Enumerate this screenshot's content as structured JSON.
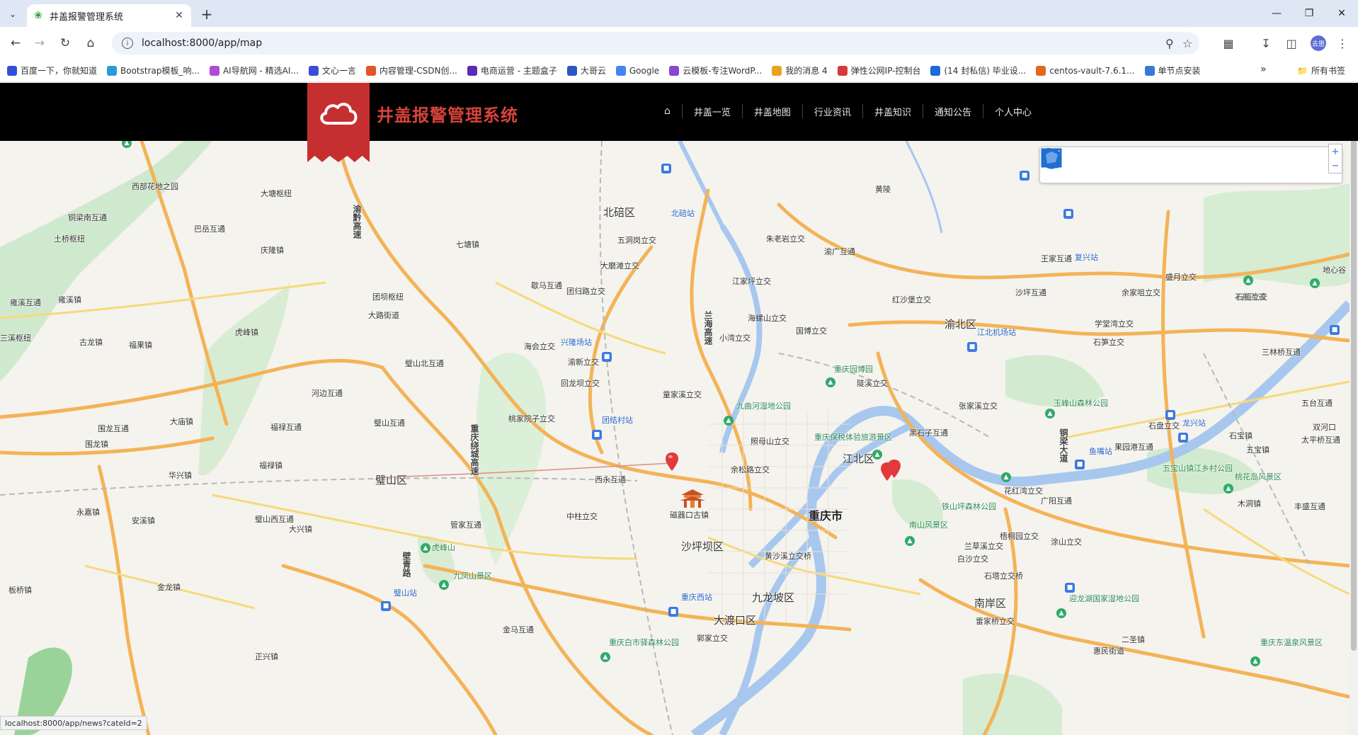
{
  "browser": {
    "tab_title": "井盖报警管理系统",
    "url": "localhost:8000/app/map",
    "avatar_text": "去思",
    "bookmarks": [
      {
        "label": "百度一下，你就知道",
        "color": "#3050d8"
      },
      {
        "label": "Bootstrap模板_响...",
        "color": "#2a9bd8"
      },
      {
        "label": "AI导航网 - 精选AI...",
        "color": "#b04ad8"
      },
      {
        "label": "文心一言",
        "color": "#3b4dd6"
      },
      {
        "label": "内容管理-CSDN创...",
        "color": "#e2542a"
      },
      {
        "label": "电商运营 - 主题盒子",
        "color": "#5a2bb5"
      },
      {
        "label": "大哥云",
        "color": "#2b55c5"
      },
      {
        "label": "Google",
        "color": "#4285f4"
      },
      {
        "label": "云模板-专注WordP...",
        "color": "#8a46d0"
      },
      {
        "label": "我的消息 4",
        "color": "#e8a31c"
      },
      {
        "label": "弹性公网IP-控制台",
        "color": "#d63a3a"
      },
      {
        "label": "(14 封私信) 毕业设...",
        "color": "#1a6bd8"
      },
      {
        "label": "centos-vault-7.6.1...",
        "color": "#e06a1a"
      },
      {
        "label": "单节点安装",
        "color": "#3a78d8"
      }
    ],
    "all_bookmarks_label": "所有书签",
    "status_url": "localhost:8000/app/news?cateId=2"
  },
  "site": {
    "title": "井盖报警管理系统",
    "nav": [
      "井盖一览",
      "井盖地图",
      "行业资讯",
      "井盖知识",
      "通知公告",
      "个人中心"
    ]
  },
  "map": {
    "tools": [
      "pan-hand-icon",
      "marker-icon",
      "circle-icon",
      "polyline-icon",
      "polygon-icon",
      "rectangle-icon"
    ],
    "labels": {
      "l1": "北碚区",
      "l2": "北碚站",
      "l3": "五洞岗立交",
      "l4": "大磨滩立交",
      "l5": "歇马互通",
      "l6": "团归路立交",
      "l7": "朱老岩立交",
      "l8": "渝广互通",
      "l9": "江家坪立交",
      "l10": "海螺山立交",
      "l11": "小湾立交",
      "l12": "国博立交",
      "l13": "渝北区",
      "l14": "江北机场站",
      "l15": "王家互通",
      "l16": "复兴站",
      "l17": "盛月立交",
      "l18": "余家咀立交",
      "l19": "石船互通",
      "l20": "沙坪互通",
      "l21": "红沙堡立交",
      "l22": "学堂湾立交",
      "l23": "石笋立交",
      "l24": "兴隆场站",
      "l25": "海会立交",
      "l26": "渝新立交",
      "l27": "璧山北互通",
      "l28": "河边互通",
      "l29": "璧山互通",
      "l30": "回龙坝立交",
      "l31": "童家溪立交",
      "l32": "九曲河湿地公园",
      "l33": "重庆园博园",
      "l34": "陡溪立交",
      "l35": "张家溪立交",
      "l36": "铁山坪森林公园",
      "l37": "黑石子互通",
      "l38": "团结村站",
      "l39": "桃家院子立交",
      "l40": "照母山立交",
      "l41": "重庆保税体验旅游景区",
      "l42": "江北区",
      "l43": "璧山区",
      "l44": "西永互通",
      "l45": "余松路立交",
      "l46": "磁器口古镇",
      "l47": "中柱立交",
      "l48": "重庆市",
      "l49": "沙坪坝区",
      "l50": "南山风景区",
      "l51": "花红湾立交",
      "l52": "广阳互通",
      "l53": "梧桐园立交",
      "l54": "涂山立交",
      "l55": "兰草溪立交",
      "l56": "黄沙溪立交桥",
      "l57": "白沙立交",
      "l58": "石塔立交桥",
      "l59": "九龙坡区",
      "l60": "重庆西站",
      "l61": "南岸区",
      "l62": "雷家桥立交",
      "l63": "大渡口区",
      "l64": "郭家立交",
      "l65": "虎峰山",
      "l66": "九凤山景区",
      "l67": "璧山站",
      "l68": "管家互通",
      "l69": "金马互通",
      "l70": "重庆白市驿森林公园",
      "l71": "迎龙湖国家湿地公园",
      "l72": "重庆东温泉风景区",
      "l73": "桃花岛风景区",
      "l74": "五宝山镇江乡村公园",
      "l75": "玉峰山森林公园",
      "l76": "鱼嘴站",
      "l77": "果园港互通",
      "l78": "石盘立交",
      "l79": "龙兴站",
      "l80": "三林桥互通",
      "l81": "五宝镇",
      "l82": "双河口",
      "l83": "太平桥互通",
      "l84": "大塘枢纽",
      "l85": "铜梁南互通",
      "l86": "土桥枢纽",
      "l87": "巴岳互通",
      "l88": "庆隆镇",
      "l89": "团坝枢纽",
      "l90": "大路街道",
      "l91": "虎峰镇",
      "l92": "福禄互通",
      "l93": "大庙镇",
      "l94": "围龙互通",
      "l95": "围龙镇",
      "l96": "永嘉镇",
      "l97": "安溪镇",
      "l98": "璧山西互通",
      "l99": "大兴镇",
      "l100": "华兴镇",
      "l101": "福禄镇",
      "l102": "古龙镇",
      "l103": "福果镇",
      "l104": "雍溪互通",
      "l105": "雍溪镇",
      "l106": "七塘镇",
      "l107": "西部花地之园",
      "l108": "三溪枢纽",
      "l109": "渝黔高速",
      "l110": "兰海高速",
      "l111": "重庆绕城高速",
      "l112": "铜梁大道",
      "l113": "壁青路",
      "l114": "金龙镇",
      "l115": "板桥镇",
      "l116": "地心谷",
      "l117": "石船立交",
      "l118": "五台互通",
      "l119": "石宝镇",
      "l120": "丰盛互通",
      "l121": "木洞镇",
      "l122": "正兴镇",
      "l123": "二圣镇",
      "l124": "惠民街道",
      "l125": "黄陵"
    }
  }
}
